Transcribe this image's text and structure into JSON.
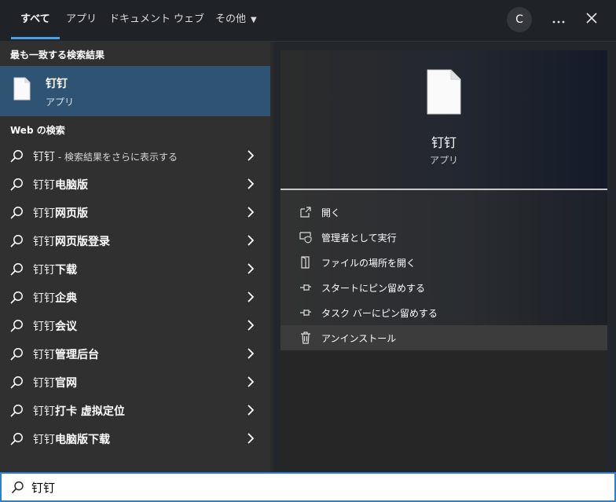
{
  "tabs": [
    {
      "label": "すべて",
      "active": true
    },
    {
      "label": "アプリ"
    },
    {
      "label": "ドキュメント"
    },
    {
      "label": "ウェブ"
    },
    {
      "label": "その他"
    }
  ],
  "topbar": {
    "avatar_letter": "C",
    "more_icon": "more-icon",
    "close_icon": "close-icon"
  },
  "best_match": {
    "heading": "最も一致する検索結果",
    "title": "钉钉",
    "subtitle": "アプリ",
    "icon": "document-icon"
  },
  "web": {
    "heading": "Web の検索",
    "results": [
      {
        "query": "钉钉",
        "suffix": " - 検索結果をさらに表示する"
      },
      {
        "query": "钉钉",
        "suffix": "电脑版"
      },
      {
        "query": "钉钉",
        "suffix": "网页版"
      },
      {
        "query": "钉钉",
        "suffix": "网页版登录"
      },
      {
        "query": "钉钉",
        "suffix": "下载"
      },
      {
        "query": "钉钉",
        "suffix": "企典"
      },
      {
        "query": "钉钉",
        "suffix": "会议"
      },
      {
        "query": "钉钉",
        "suffix": "管理后台"
      },
      {
        "query": "钉钉",
        "suffix": "官网"
      },
      {
        "query": "钉钉",
        "suffix": "打卡 虚拟定位"
      },
      {
        "query": "钉钉",
        "suffix": "电脑版下载"
      }
    ]
  },
  "preview": {
    "title": "钉钉",
    "subtitle": "アプリ"
  },
  "actions": [
    {
      "label": "開く",
      "icon": "open-icon"
    },
    {
      "label": "管理者として実行",
      "icon": "shield-admin-icon"
    },
    {
      "label": "ファイルの場所を開く",
      "icon": "file-location-icon"
    },
    {
      "label": "スタートにピン留めする",
      "icon": "pin-icon"
    },
    {
      "label": "タスク バーにピン留めする",
      "icon": "pin-icon"
    },
    {
      "label": "アンインストール",
      "icon": "trash-icon"
    }
  ],
  "search": {
    "value": "钉钉",
    "icon": "search-icon"
  }
}
